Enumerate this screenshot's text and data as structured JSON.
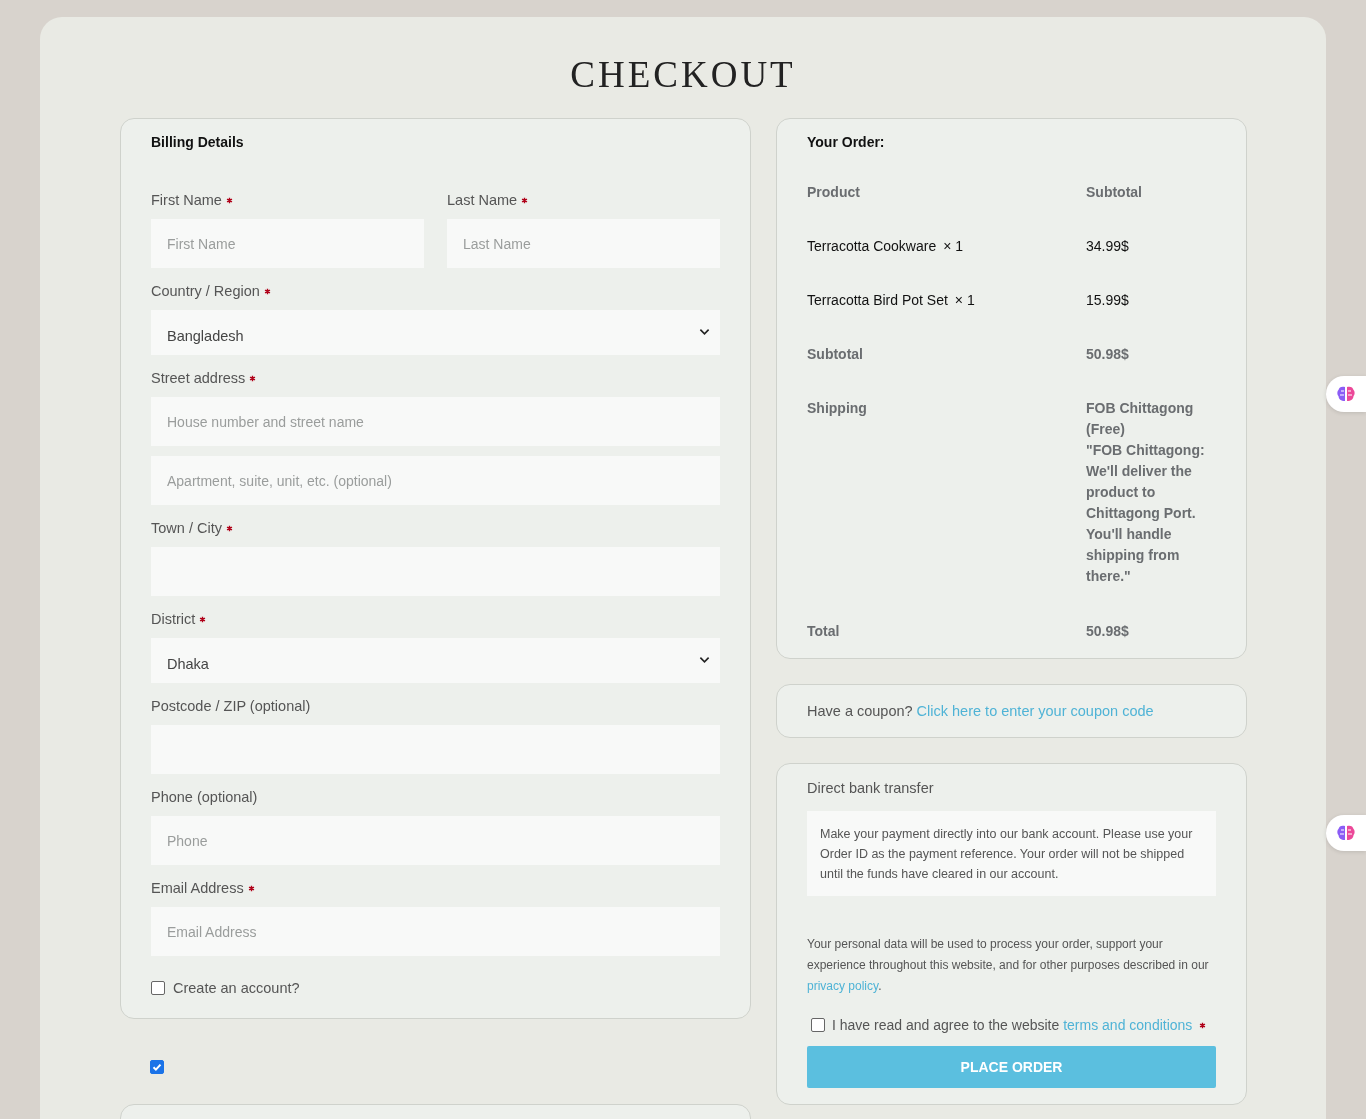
{
  "page_title": "CHECKOUT",
  "billing": {
    "title": "Billing Details",
    "rows": [
      {
        "fields": [
          {
            "kind": "input",
            "label": "First Name",
            "required": true,
            "placeholder": "First Name"
          },
          {
            "kind": "input",
            "label": "Last Name",
            "required": true,
            "placeholder": "Last Name"
          }
        ]
      },
      {
        "fields": [
          {
            "kind": "select",
            "label": "Country / Region",
            "required": true,
            "value": "Bangladesh"
          }
        ]
      },
      {
        "fields": [
          {
            "kind": "input",
            "label": "Street address",
            "required": true,
            "placeholder": "House number and street name"
          }
        ]
      },
      {
        "fields": [
          {
            "kind": "input",
            "placeholder": "Apartment, suite, unit, etc. (optional)"
          }
        ]
      },
      {
        "fields": [
          {
            "kind": "input",
            "label": "Town / City",
            "required": true
          }
        ]
      },
      {
        "fields": [
          {
            "kind": "select",
            "label": "District",
            "required": true,
            "value": "Dhaka"
          }
        ]
      },
      {
        "fields": [
          {
            "kind": "input",
            "label": "Postcode / ZIP (optional)",
            "required": false
          }
        ]
      },
      {
        "fields": [
          {
            "kind": "input",
            "label": "Phone (optional)",
            "required": false,
            "placeholder": "Phone"
          }
        ]
      },
      {
        "fields": [
          {
            "kind": "input",
            "label": "Email Address",
            "required": true,
            "placeholder": "Email Address"
          }
        ]
      }
    ],
    "create_account": {
      "label": "Create an account?",
      "checked": false
    }
  },
  "extra_checkbox": {
    "checked": true
  },
  "order": {
    "title": "Your Order:",
    "rows": [
      {
        "kind": "header",
        "label": "Product",
        "value": "Subtotal"
      },
      {
        "kind": "item",
        "label": "Terracotta Cookware",
        "quantity": "× 1",
        "value": "34.99$"
      },
      {
        "kind": "item",
        "label": "Terracotta Bird Pot Set",
        "quantity": "× 1",
        "value": "15.99$"
      },
      {
        "kind": "summary",
        "label": "Subtotal",
        "value": "50.98$"
      },
      {
        "kind": "summary",
        "label": "Shipping",
        "value": "FOB Chittagong (Free)",
        "note": "\"FOB Chittagong: We'll deliver the product to Chittagong Port. You'll handle shipping from there.\""
      },
      {
        "kind": "summary",
        "label": "Total",
        "value": "50.98$"
      }
    ]
  },
  "coupon": {
    "text": "Have a coupon?",
    "link": "Click here to enter your coupon code"
  },
  "payment": {
    "method": "Direct bank transfer",
    "description": "Make your payment directly into our bank account. Please use your Order ID as the payment reference. Your order will not be shipped until the funds have cleared in our account.",
    "privacy_text": "Your personal data will be used to process your order, support your experience throughout this website, and for other purposes described in our",
    "privacy_link": "privacy policy",
    "privacy_end": ".",
    "terms": {
      "text": "I have read and agree to the website",
      "link": "terms and conditions",
      "required": true,
      "checked": false
    },
    "button": "PLACE ORDER"
  }
}
